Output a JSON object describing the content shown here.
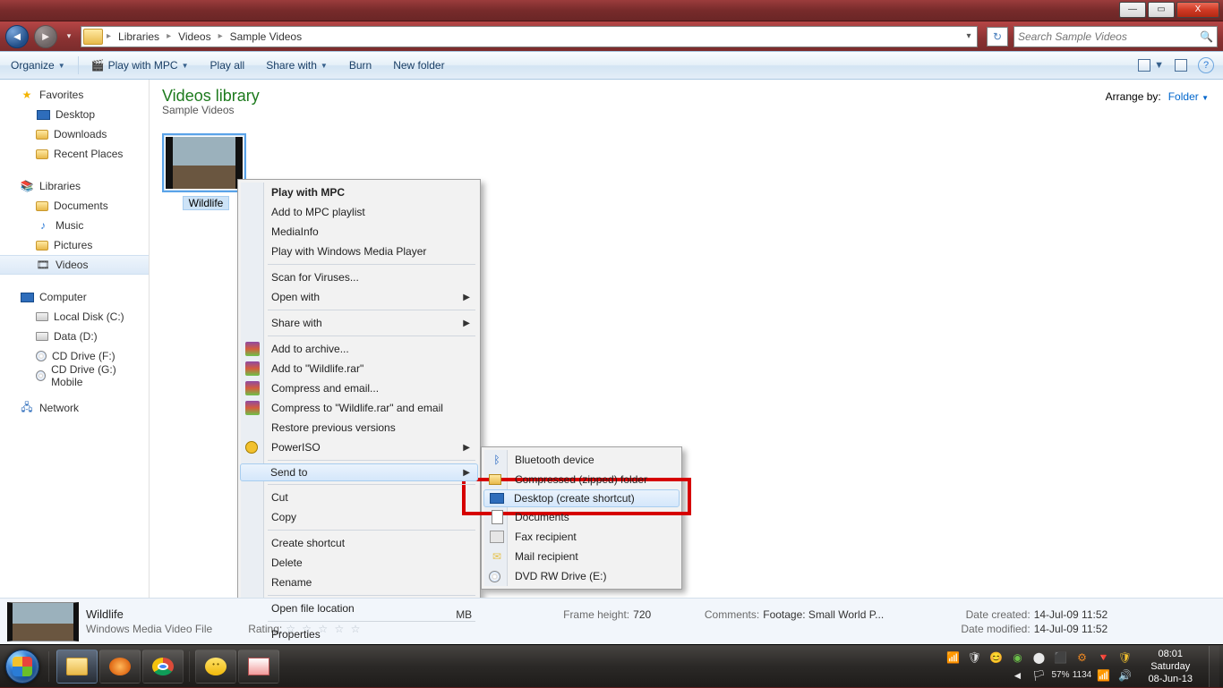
{
  "window_controls": {
    "min": "—",
    "max": "▭",
    "close": "X"
  },
  "nav": {
    "crumbs": [
      "Libraries",
      "Videos",
      "Sample Videos"
    ],
    "search_placeholder": "Search Sample Videos"
  },
  "toolbar": {
    "organize": "Organize",
    "play_mpc": "Play with MPC",
    "play_all": "Play all",
    "share_with": "Share with",
    "burn": "Burn",
    "new_folder": "New folder"
  },
  "sidebar": {
    "favorites": {
      "label": "Favorites",
      "items": [
        "Desktop",
        "Downloads",
        "Recent Places"
      ]
    },
    "libraries": {
      "label": "Libraries",
      "items": [
        "Documents",
        "Music",
        "Pictures",
        "Videos"
      ],
      "selected": 3
    },
    "computer": {
      "label": "Computer",
      "items": [
        "Local Disk (C:)",
        "Data (D:)",
        "CD Drive (F:)",
        "CD Drive (G:) Mobile"
      ]
    },
    "network": {
      "label": "Network"
    }
  },
  "library": {
    "title": "Videos library",
    "subtitle": "Sample Videos",
    "arrange_label": "Arrange by:",
    "arrange_value": "Folder"
  },
  "file": {
    "name": "Wildlife"
  },
  "ctx": {
    "items": [
      {
        "t": "Play with MPC",
        "bold": true
      },
      {
        "t": "Add to MPC playlist"
      },
      {
        "t": "MediaInfo"
      },
      {
        "t": "Play with Windows Media Player"
      },
      {
        "sep": true
      },
      {
        "t": "Scan for Viruses..."
      },
      {
        "t": "Open with",
        "sub": true
      },
      {
        "sep": true
      },
      {
        "t": "Share with",
        "sub": true
      },
      {
        "sep": true
      },
      {
        "t": "Add to archive...",
        "icon": "rar"
      },
      {
        "t": "Add to \"Wildlife.rar\"",
        "icon": "rar"
      },
      {
        "t": "Compress and email...",
        "icon": "rar"
      },
      {
        "t": "Compress to \"Wildlife.rar\" and email",
        "icon": "rar"
      },
      {
        "t": "Restore previous versions"
      },
      {
        "t": "PowerISO",
        "sub": true,
        "icon": "piso"
      },
      {
        "sep": true
      },
      {
        "t": "Send to",
        "sub": true,
        "hover": true
      },
      {
        "sep": true
      },
      {
        "t": "Cut"
      },
      {
        "t": "Copy"
      },
      {
        "sep": true
      },
      {
        "t": "Create shortcut"
      },
      {
        "t": "Delete"
      },
      {
        "t": "Rename"
      },
      {
        "sep": true
      },
      {
        "t": "Open file location"
      },
      {
        "sep": true
      },
      {
        "t": "Properties"
      }
    ]
  },
  "sendto": {
    "items": [
      {
        "t": "Bluetooth device",
        "icon": "bt"
      },
      {
        "t": "Compressed (zipped) folder",
        "icon": "zip"
      },
      {
        "t": "Desktop (create shortcut)",
        "icon": "desk",
        "hover": true
      },
      {
        "t": "Documents",
        "icon": "docs"
      },
      {
        "t": "Fax recipient",
        "icon": "fax"
      },
      {
        "t": "Mail recipient",
        "icon": "mail"
      },
      {
        "t": "DVD RW Drive (E:)",
        "icon": "dvd"
      }
    ]
  },
  "details": {
    "name": "Wildlife",
    "type": "Windows Media Video File",
    "size_label": "MB",
    "rating_label": "Rating:",
    "frame_h_label": "Frame height:",
    "frame_h": "720",
    "comments_label": "Comments:",
    "comments": "Footage: Small World P...",
    "date_created_label": "Date created:",
    "date_created": "14-Jul-09 11:52",
    "date_modified_label": "Date modified:",
    "date_modified": "14-Jul-09 11:52"
  },
  "taskbar": {
    "clock_time": "08:01",
    "clock_day": "Saturday",
    "clock_date": "08-Jun-13",
    "battery": "57%",
    "mem": "1134"
  }
}
